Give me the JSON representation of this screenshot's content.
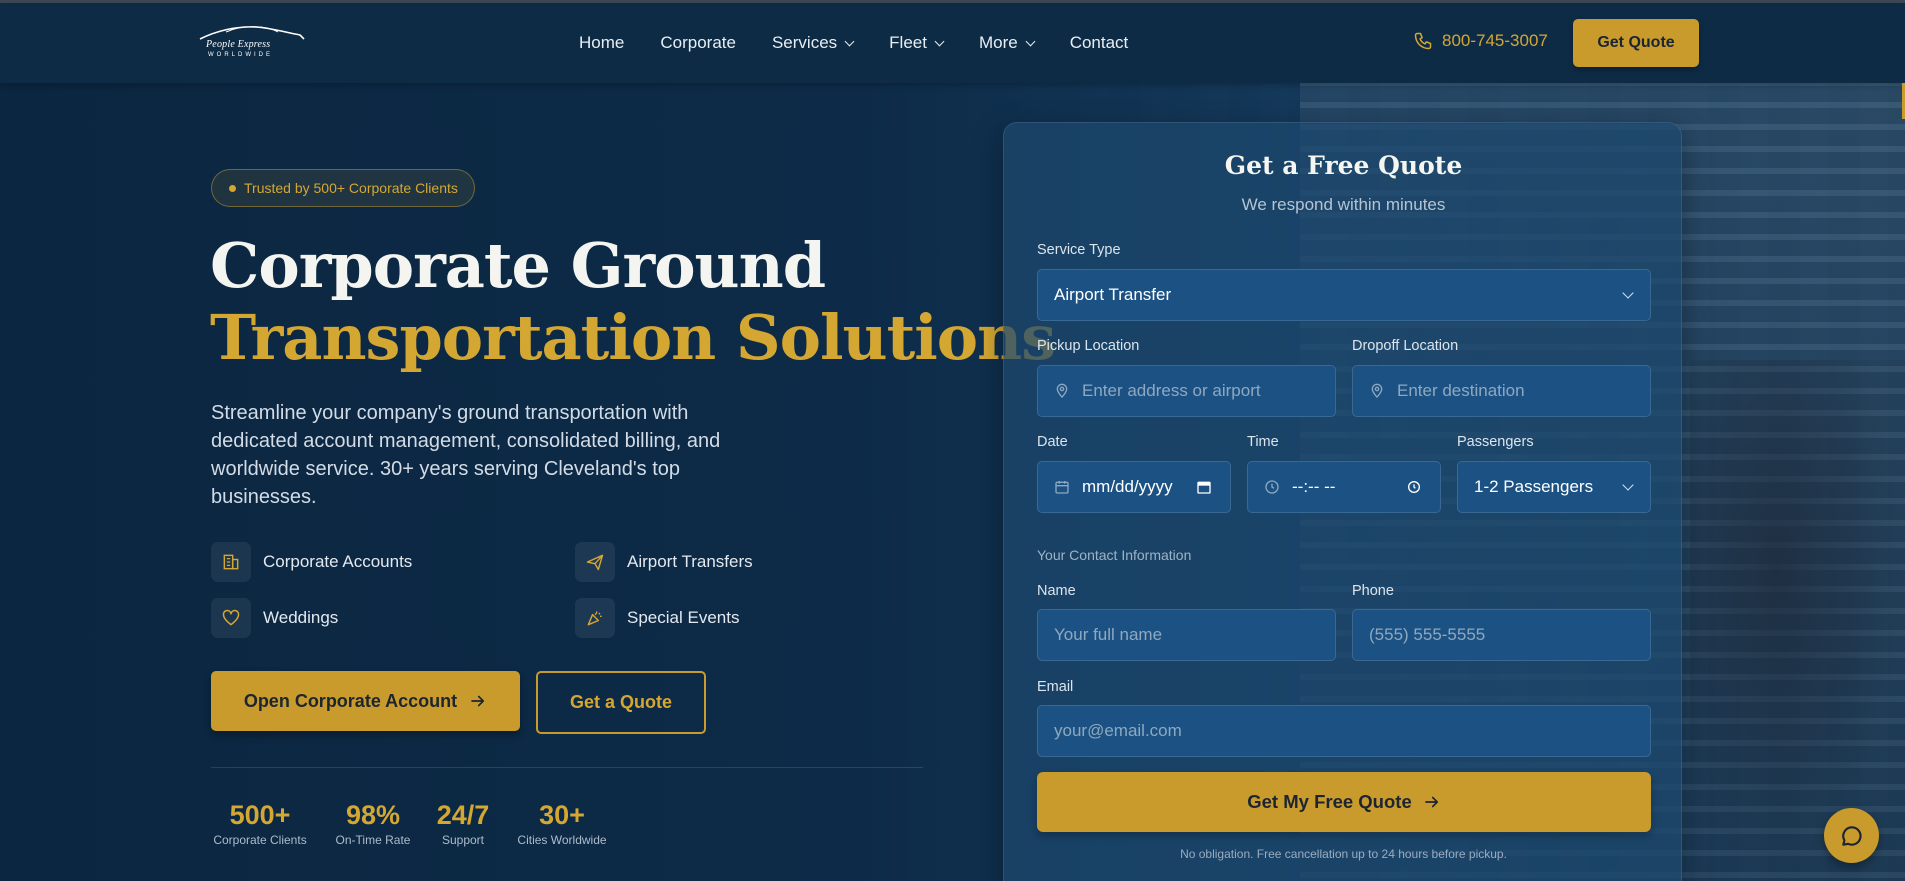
{
  "header": {
    "logo_text": "People Express",
    "logo_subtext": "WORLDWIDE",
    "nav": [
      {
        "label": "Home"
      },
      {
        "label": "Corporate"
      },
      {
        "label": "Services"
      },
      {
        "label": "Fleet"
      },
      {
        "label": "More"
      },
      {
        "label": "Contact"
      }
    ],
    "phone": "800-745-3007",
    "cta": "Get Quote"
  },
  "hero": {
    "badge": "Trusted by 500+ Corporate Clients",
    "title_line1": "Corporate Ground",
    "title_line2": "Transportation Solutions",
    "description": "Streamline your company's ground transportation with dedicated account management, consolidated billing, and worldwide service. 30+ years serving Cleveland's top businesses.",
    "features": [
      {
        "label": "Corporate Accounts",
        "icon": "building-icon"
      },
      {
        "label": "Airport Transfers",
        "icon": "plane-icon"
      },
      {
        "label": "Weddings",
        "icon": "heart-icon"
      },
      {
        "label": "Special Events",
        "icon": "party-icon"
      }
    ],
    "primary_button": "Open Corporate Account",
    "secondary_button": "Get a Quote",
    "stats": [
      {
        "value": "500+",
        "label": "Corporate Clients"
      },
      {
        "value": "98%",
        "label": "On-Time Rate"
      },
      {
        "value": "24/7",
        "label": "Support"
      },
      {
        "value": "30+",
        "label": "Cities Worldwide"
      }
    ]
  },
  "quote_form": {
    "title": "Get a Free Quote",
    "subtitle": "We respond within minutes",
    "service_type_label": "Service Type",
    "service_type_value": "Airport Transfer",
    "pickup_label": "Pickup Location",
    "pickup_placeholder": "Enter address or airport",
    "dropoff_label": "Dropoff Location",
    "dropoff_placeholder": "Enter destination",
    "date_label": "Date",
    "date_placeholder": "mm/dd/yyyy",
    "time_label": "Time",
    "time_placeholder": "--:-- --",
    "passengers_label": "Passengers",
    "passengers_value": "1-2 Passengers",
    "contact_section": "Your Contact Information",
    "name_label": "Name",
    "name_placeholder": "Your full name",
    "phone_label": "Phone",
    "phone_placeholder": "(555) 555-5555",
    "email_label": "Email",
    "email_placeholder": "your@email.com",
    "submit": "Get My Free Quote",
    "disclaimer": "No obligation. Free cancellation up to 24 hours before pickup."
  },
  "colors": {
    "accent": "#c89b2c",
    "background": "#0c2a45",
    "card": "#1c5283"
  }
}
